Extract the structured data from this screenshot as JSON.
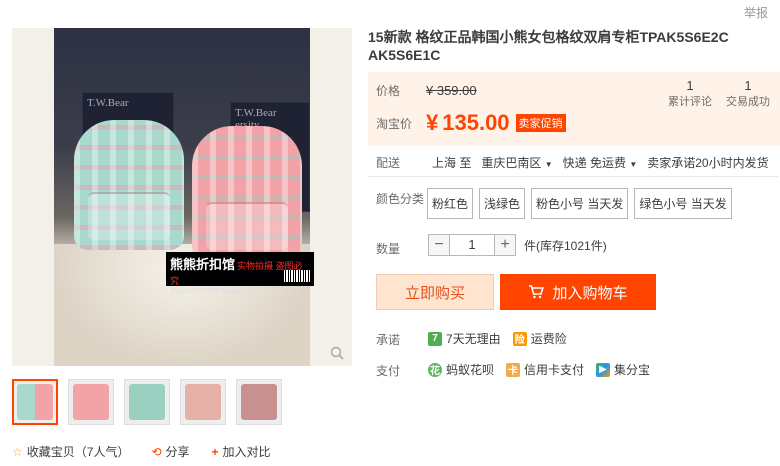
{
  "report_label": "举报",
  "main_image": {
    "box_text_1": "T.W.Bear",
    "box_text_2": "ersity",
    "watermark_title": "熊熊折扣馆",
    "watermark_tag": "实物拍摄 盗图必究",
    "watermark_url": "shop110417629.taobao.com"
  },
  "thumb_colors": [
    "#a9d8cc",
    "#f1a3a8",
    "#9ad0c0",
    "#e5b0a8",
    "#c89090"
  ],
  "share": {
    "favorite_label": "收藏宝贝（7人气）",
    "share_label": "分享",
    "compare_label": "加入对比"
  },
  "product": {
    "title": "15新款 格纹正品韩国小熊女包格纹双肩专柜TPAK5S6E2C AK5S6E1C"
  },
  "price": {
    "original_label": "价格",
    "original_price": "¥ 359.00",
    "taobao_label": "淘宝价",
    "yen": "¥",
    "current_price": "135.00",
    "promo_badge": "卖家促销"
  },
  "stats": {
    "reviews_count": "1",
    "reviews_label": "累计评论",
    "sales_count": "1",
    "sales_label": "交易成功"
  },
  "shipping": {
    "label": "配送",
    "from": "上海 至",
    "to": "重庆巴南区",
    "method": "快递 免运费",
    "promise": "卖家承诺20小时内发货"
  },
  "color_option": {
    "label": "颜色分类",
    "options": [
      "粉红色",
      "浅绿色",
      "粉色小号 当天发",
      "绿色小号 当天发"
    ]
  },
  "quantity": {
    "label": "数量",
    "value": "1",
    "stock": "件(库存1021件)"
  },
  "buttons": {
    "buy_now": "立即购买",
    "add_cart": "加入购物车"
  },
  "promise": {
    "label": "承诺",
    "items": [
      "7天无理由",
      "运费险"
    ]
  },
  "payment": {
    "label": "支付",
    "items": [
      "蚂蚁花呗",
      "信用卡支付",
      "集分宝"
    ]
  },
  "colors": {
    "accent": "#ff4400",
    "price_bg": "#fff2e8"
  }
}
